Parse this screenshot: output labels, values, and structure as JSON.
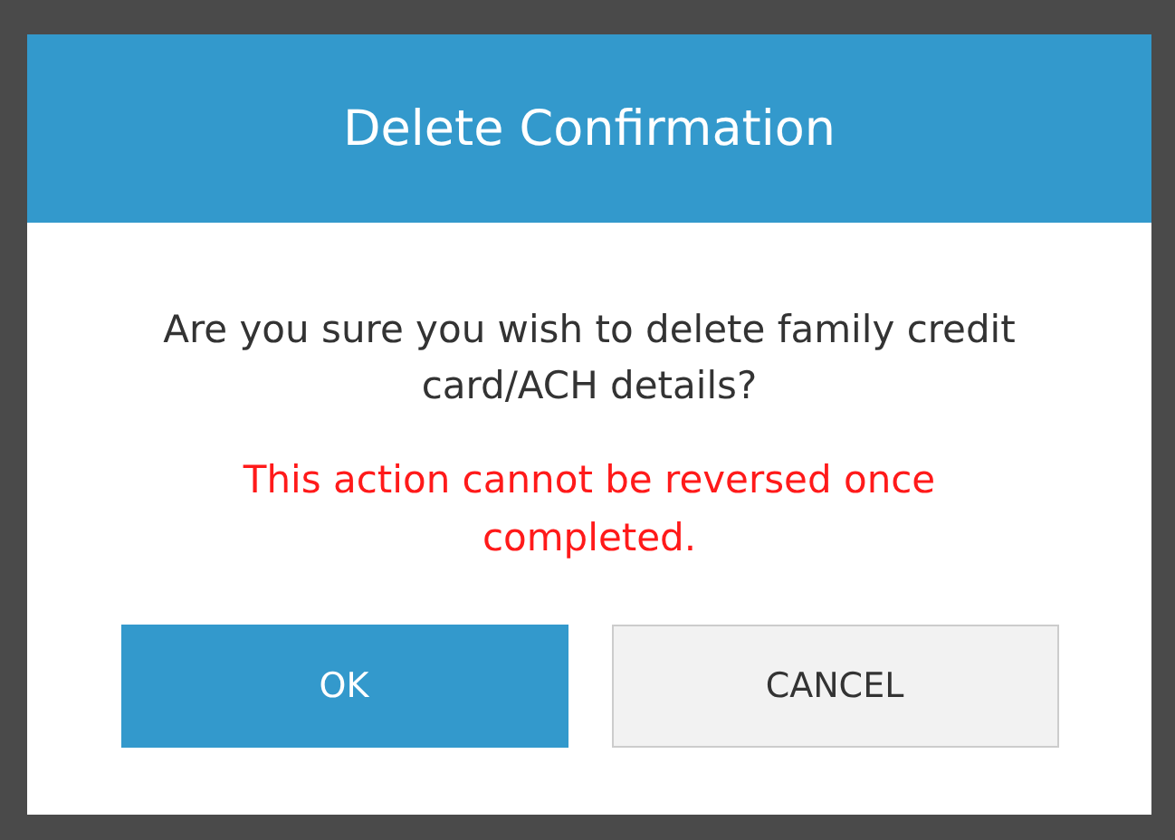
{
  "dialog": {
    "title": "Delete Confirmation",
    "message": "Are you sure you wish to delete family credit card/ACH details?",
    "warning": "This action cannot be reversed once completed.",
    "buttons": [
      {
        "label": "OK",
        "kind": "primary"
      },
      {
        "label": "CANCEL",
        "kind": "secondary"
      }
    ]
  }
}
